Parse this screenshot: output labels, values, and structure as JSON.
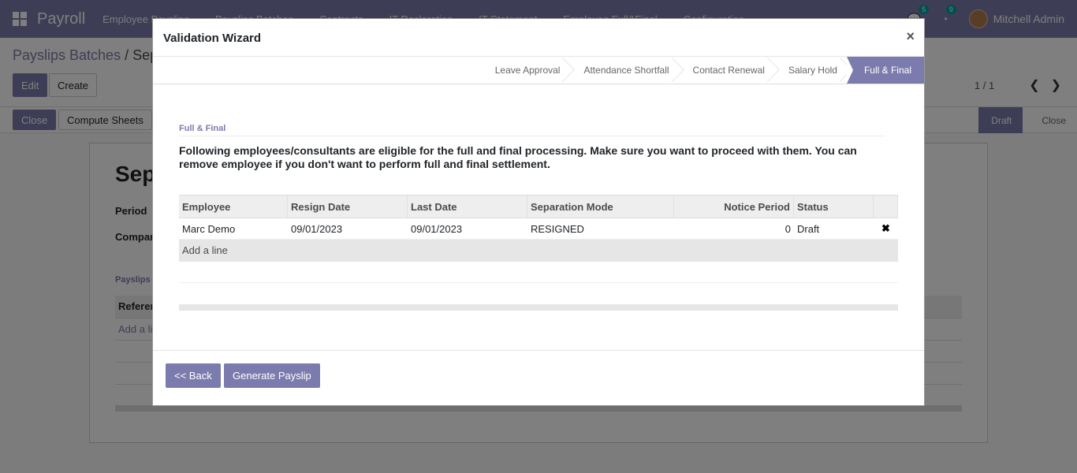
{
  "navbar": {
    "brand": "Payroll",
    "menu": [
      "Employee Payslips",
      "Payslips Batches",
      "Contracts",
      "IT Declaration",
      "IT Statement",
      "Employee Full&Final",
      "Configuration"
    ],
    "messages_count": "5",
    "activities_count": "9",
    "user": "Mitchell Admin"
  },
  "control": {
    "breadcrumb_root": "Payslips Batches",
    "breadcrumb_sep": " / ",
    "breadcrumb_current": "Sep",
    "edit_label": "Edit",
    "create_label": "Create",
    "pager": "1 / 1"
  },
  "statusbar": {
    "close_label": "Close",
    "compute_label": "Compute Sheets",
    "stages": [
      "Draft",
      "Close"
    ],
    "active_stage": "Draft"
  },
  "sheet": {
    "title": "Sep",
    "period_label": "Period",
    "company_label": "Compar",
    "tab_label": "Payslips",
    "col_reference": "Referen",
    "add_line": "Add a li"
  },
  "modal": {
    "title": "Validation Wizard",
    "close_symbol": "×",
    "steps": [
      "Leave Approval",
      "Attendance Shortfall",
      "Contact Renewal",
      "Salary Hold",
      "Full & Final"
    ],
    "section_label": "Full & Final",
    "message": "Following employees/consultants are eligible for the full and final processing. Make sure you want to proceed with them. You can remove employee if you don't want to perform full and final settlement.",
    "columns": {
      "employee": "Employee",
      "resign_date": "Resign Date",
      "last_date": "Last Date",
      "separation_mode": "Separation Mode",
      "notice_period": "Notice Period",
      "status": "Status"
    },
    "rows": [
      {
        "employee": "Marc Demo",
        "resign_date": "09/01/2023",
        "last_date": "09/01/2023",
        "separation_mode": "RESIGNED",
        "notice_period": "0",
        "status": "Draft",
        "delete_symbol": "✖"
      }
    ],
    "add_line": "Add a line",
    "back_label": "<< Back",
    "generate_label": "Generate Payslip"
  }
}
